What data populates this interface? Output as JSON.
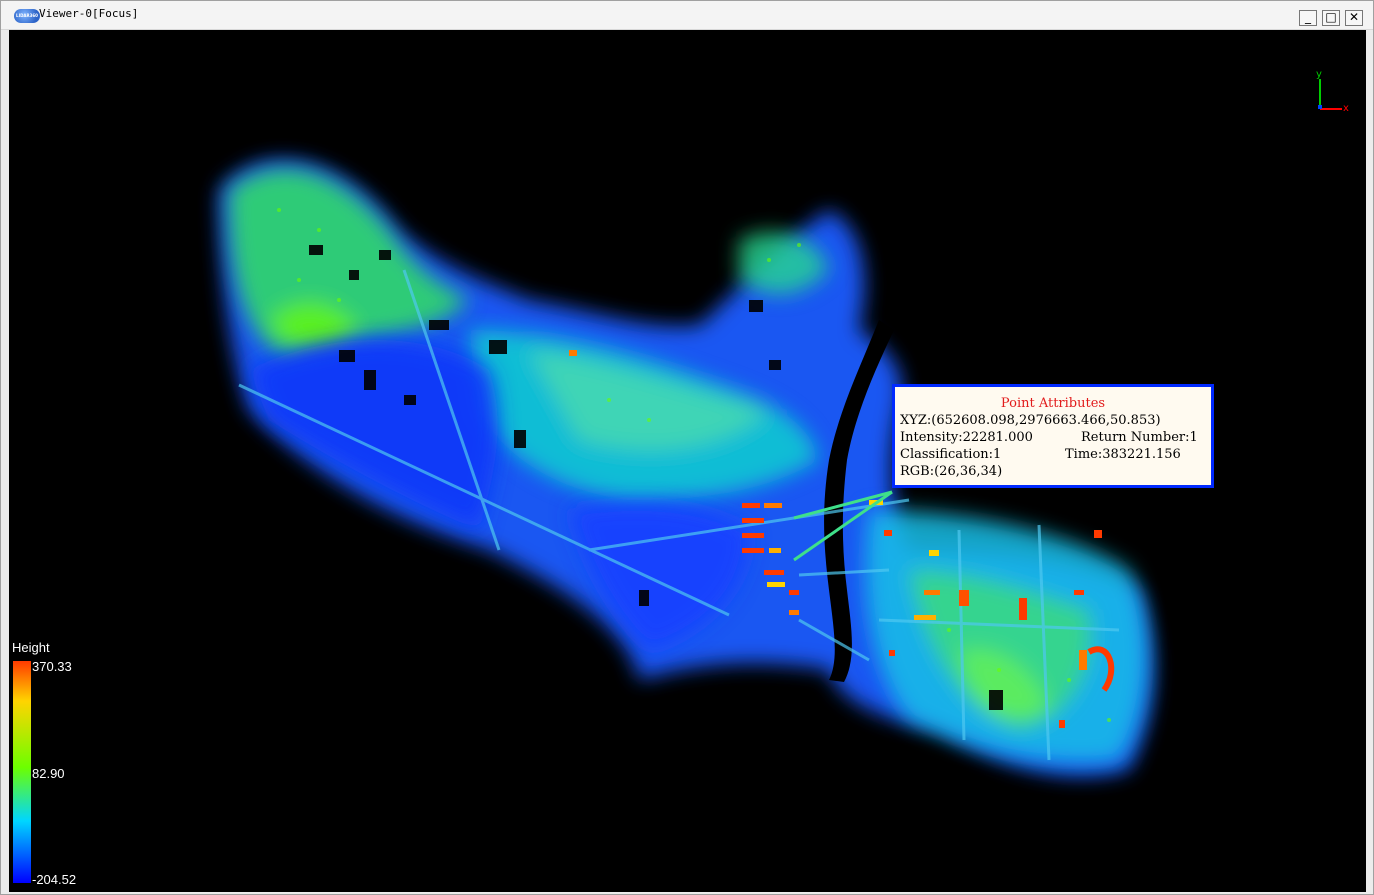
{
  "window": {
    "title": "Viewer-0[Focus]",
    "logo_text": "LIDAR360",
    "controls": {
      "minimize": "_",
      "maximize": "□",
      "close": "✕"
    }
  },
  "viewport": {
    "axis": {
      "y_label": "y",
      "x_label": "x"
    },
    "legend": {
      "title": "Height",
      "max": "370.33",
      "mid": "82.90",
      "min": "-204.52"
    },
    "point_attributes": {
      "title": "Point Attributes",
      "xyz": "XYZ:(652608.098,2976663.466,50.853)",
      "intensity": "Intensity:22281.000",
      "return_number": "Return Number:1",
      "classification": "Classification:1",
      "time": "Time:383221.156",
      "rgb": "RGB:(26,36,34)"
    }
  },
  "colors": {
    "accent_border": "#0029ff",
    "popup_title": "#e21b1b",
    "high": "#ff3a00",
    "mid": "#6cff00",
    "low": "#0000ff"
  }
}
